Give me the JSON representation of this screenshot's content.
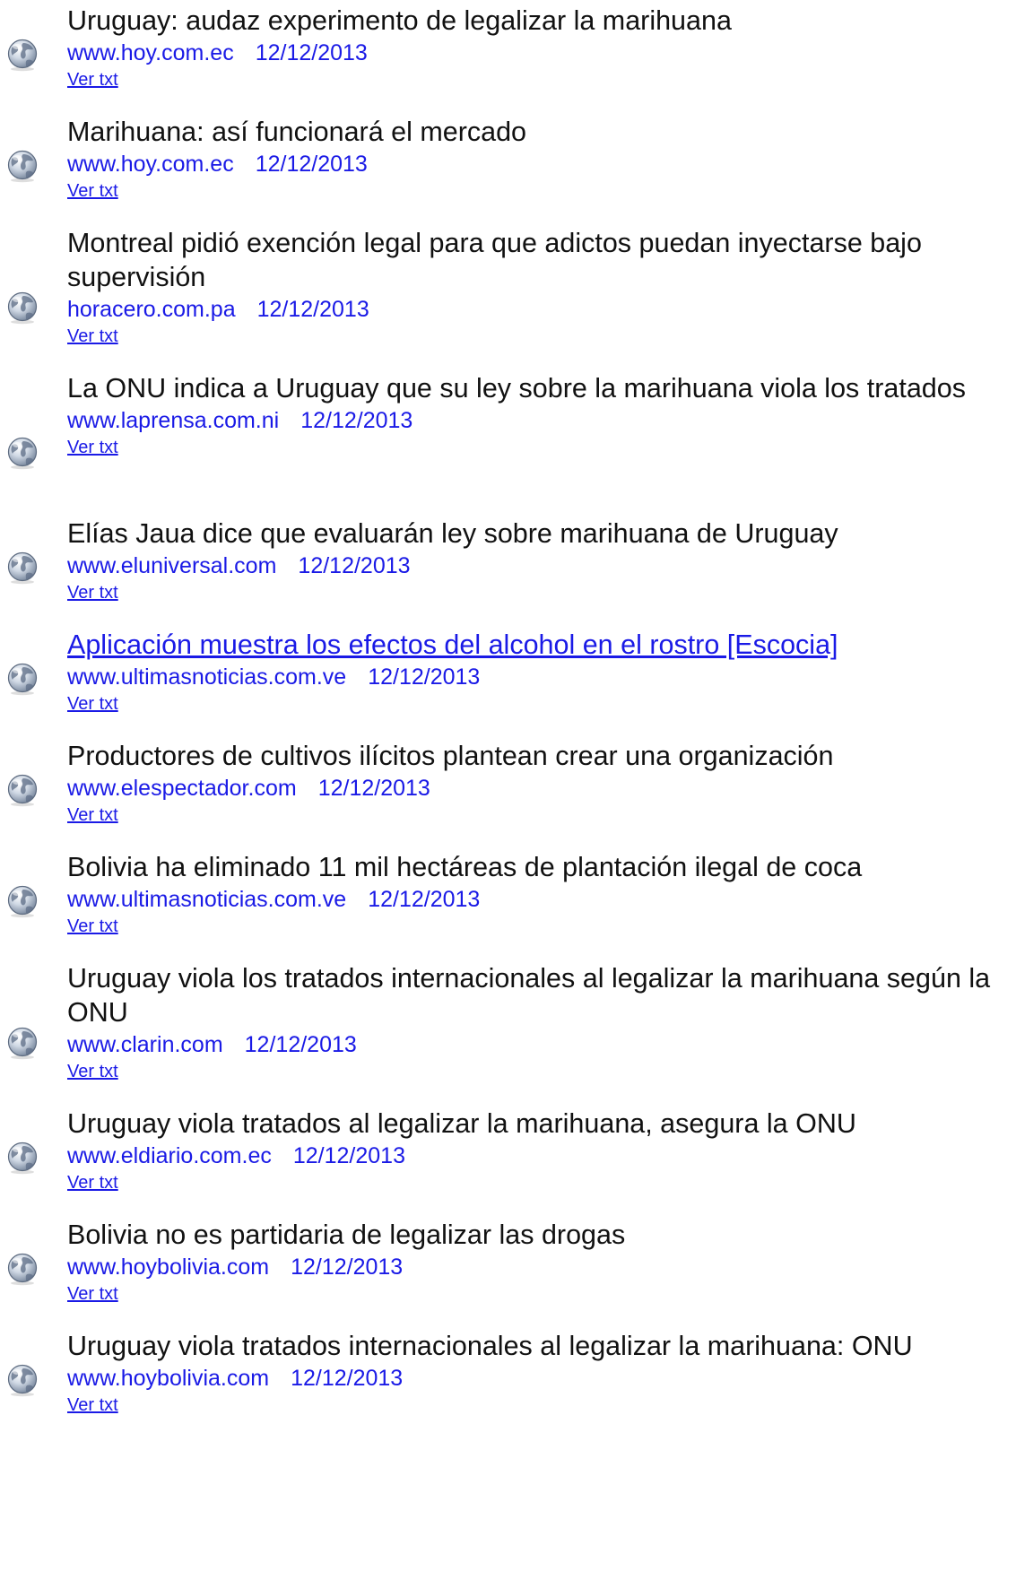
{
  "icon": "globe-icon",
  "colors": {
    "link": "#1a1ae6",
    "headline": "#111111",
    "background": "#ffffff"
  },
  "items": [
    {
      "headline": "Uruguay: audaz experimento de legalizar la marihuana",
      "source": "www.hoy.com.ec",
      "date": "12/12/2013",
      "link_label": "Ver txt "
    },
    {
      "headline": "Marihuana: así funcionará el mercado",
      "source": "www.hoy.com.ec",
      "date": "12/12/2013",
      "link_label": "Ver txt "
    },
    {
      "headline": "Montreal pidió exención legal para que adictos puedan inyectarse bajo supervisión",
      "source": "horacero.com.pa",
      "date": "12/12/2013",
      "link_label": "Ver txt "
    },
    {
      "headline": "La ONU indica a Uruguay que su ley sobre la marihuana viola los tratados",
      "source": "www.laprensa.com.ni",
      "date": "12/12/2013",
      "link_label": "Ver txt "
    },
    {
      "headline": "Elías Jaua dice que evaluarán ley sobre marihuana de Uruguay",
      "source": "www.eluniversal.com",
      "date": "12/12/2013",
      "link_label": "Ver txt "
    },
    {
      "headline": "Aplicación muestra los efectos del alcohol en el rostro [Escocia]",
      "source": "www.ultimasnoticias.com.ve",
      "date": "12/12/2013",
      "link_label": "Ver txt "
    },
    {
      "headline": "Productores de cultivos ilícitos plantean crear una organización",
      "source": "www.elespectador.com",
      "date": "12/12/2013",
      "link_label": "Ver txt "
    },
    {
      "headline": "Bolivia ha eliminado 11 mil hectáreas de plantación ilegal de coca",
      "source": "www.ultimasnoticias.com.ve",
      "date": "12/12/2013",
      "link_label": "Ver txt "
    },
    {
      "headline": "Uruguay viola los tratados internacionales al legalizar la marihuana según la ONU",
      "source": "www.clarin.com",
      "date": "12/12/2013",
      "link_label": "Ver txt "
    },
    {
      "headline": "Uruguay viola tratados al legalizar la marihuana, asegura la ONU",
      "source": "www.eldiario.com.ec",
      "date": "12/12/2013",
      "link_label": "Ver txt "
    },
    {
      "headline": "Bolivia no es partidaria de legalizar las drogas",
      "source": "www.hoybolivia.com",
      "date": "12/12/2013",
      "link_label": "Ver txt "
    },
    {
      "headline": "Uruguay viola tratados internacionales al legalizar la marihuana: ONU",
      "source": "www.hoybolivia.com",
      "date": "12/12/2013",
      "link_label": "Ver txt"
    }
  ]
}
